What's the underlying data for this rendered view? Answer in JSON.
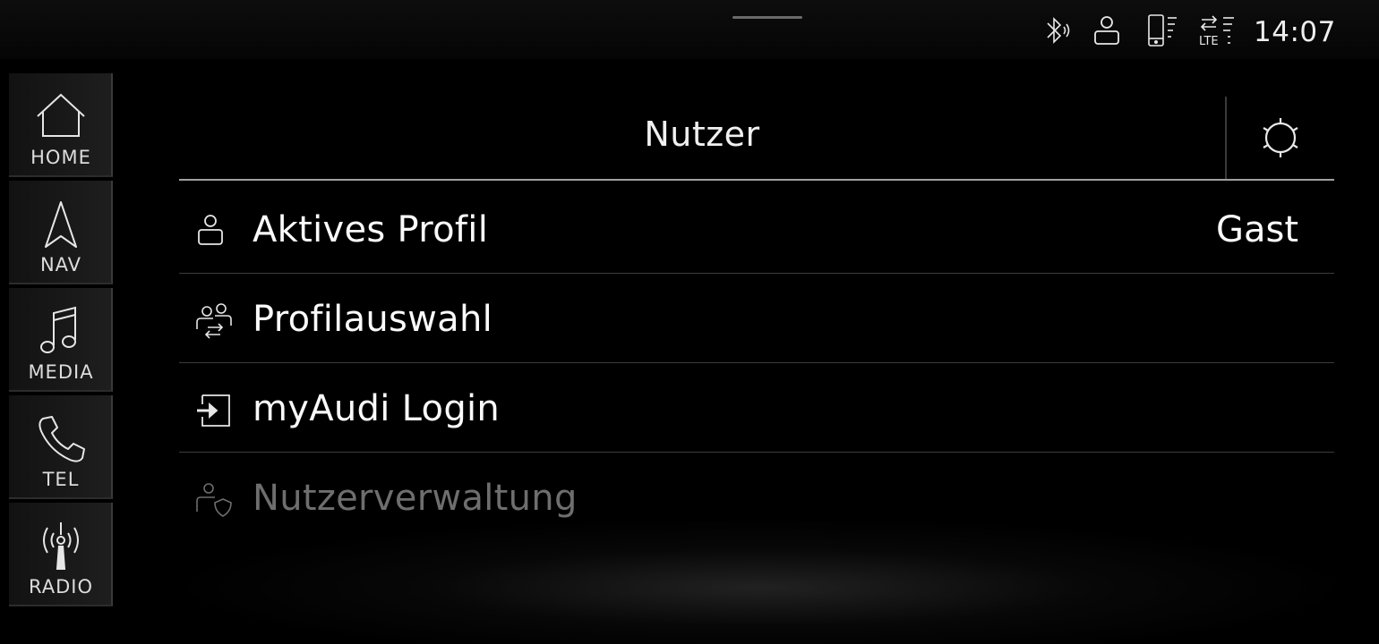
{
  "statusbar": {
    "icons": [
      "bluetooth-icon",
      "user-icon",
      "phone-signal-icon",
      "lte-icon"
    ],
    "lte_label": "LTE",
    "time": "14:07"
  },
  "sidebar": {
    "items": [
      {
        "label": "HOME",
        "icon": "home-icon"
      },
      {
        "label": "NAV",
        "icon": "navigation-arrow-icon"
      },
      {
        "label": "MEDIA",
        "icon": "music-note-icon"
      },
      {
        "label": "TEL",
        "icon": "phone-icon"
      },
      {
        "label": "RADIO",
        "icon": "radio-antenna-icon"
      }
    ]
  },
  "header": {
    "title": "Nutzer",
    "settings_icon": "gear-icon"
  },
  "list": {
    "items": [
      {
        "label": "Aktives Profil",
        "value": "Gast",
        "icon": "user-icon",
        "enabled": true
      },
      {
        "label": "Profilauswahl",
        "value": "",
        "icon": "user-switch-icon",
        "enabled": true
      },
      {
        "label": "myAudi Login",
        "value": "",
        "icon": "login-icon",
        "enabled": true
      },
      {
        "label": "Nutzerverwaltung",
        "value": "",
        "icon": "user-shield-icon",
        "enabled": false
      }
    ]
  },
  "colors": {
    "background": "#000000",
    "text": "#fafafa",
    "disabled_text": "#6e6e6e",
    "divider": "#3c3c3c"
  }
}
